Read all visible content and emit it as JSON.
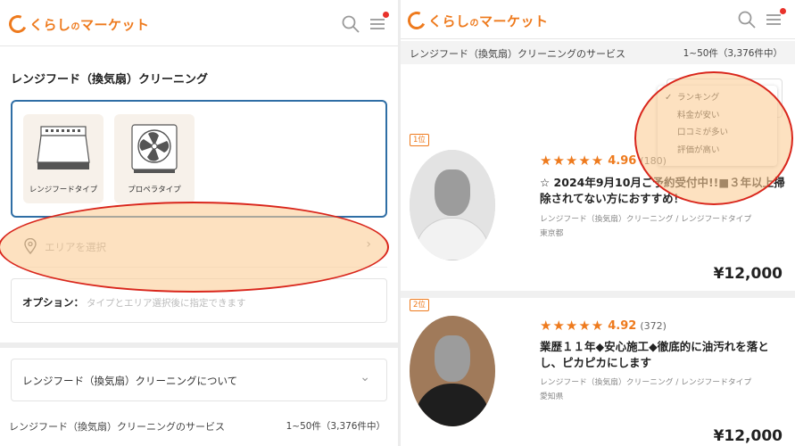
{
  "brand": {
    "name_prefix": "くらし",
    "name_no": "の",
    "name_suffix": "マーケット",
    "color": "#ee7a1d"
  },
  "icons": {
    "search": "search-icon",
    "menu": "hamburger-menu-icon",
    "pin": "location-pin-icon",
    "chevron": "chevron-right-icon"
  },
  "left": {
    "page_title": "レンジフード（換気扇）クリーニング",
    "types": [
      {
        "label": "レンジフードタイプ",
        "icon": "range-hood-icon"
      },
      {
        "label": "プロペラタイプ",
        "icon": "propeller-fan-icon"
      }
    ],
    "area_placeholder": "エリアを選択",
    "area_chevron": "›",
    "option_label": "オプション：",
    "option_hint": "タイプとエリア選択後に指定できます",
    "about_label": "レンジフード（換気扇）クリーニングについて",
    "about_chevron": "⌄",
    "services_title": "レンジフード（換気扇）クリーニングのサービス",
    "services_count": "1~50件（3,376件中）"
  },
  "right": {
    "services_title": "レンジフード（換気扇）クリーニングのサービス",
    "services_count": "1~50件（3,376件中）",
    "sort_options": [
      {
        "label": "ランキング",
        "check": "✓"
      },
      {
        "label": "料金が安い",
        "check": ""
      },
      {
        "label": "口コミが多い",
        "check": ""
      },
      {
        "label": "評価が高い",
        "check": ""
      }
    ],
    "listings": [
      {
        "rank": "1位",
        "stars": "★★★★★",
        "rating": "4.96",
        "reviews": "(180)",
        "title": "☆ 2024年9月10月ご予約受付中!!■３年以上掃除されてない方におすすめ！",
        "category": "レンジフード（換気扇）クリーニング / レンジフードタイプ",
        "location": "東京都",
        "price": "¥12,000"
      },
      {
        "rank": "2位",
        "stars": "★★★★★",
        "rating": "4.92",
        "reviews": "(372)",
        "title": "業歴１１年◆安心施工◆徹底的に油汚れを落とし、ピカピカにします",
        "category": "レンジフード（換気扇）クリーニング / レンジフードタイプ",
        "location": "愛知県",
        "price": "¥12,000"
      }
    ]
  },
  "colors": {
    "accent": "#ee7a1d",
    "selected_border": "#2f6ea5",
    "notification": "#e8322b",
    "annotation_ring": "#d9261c"
  }
}
